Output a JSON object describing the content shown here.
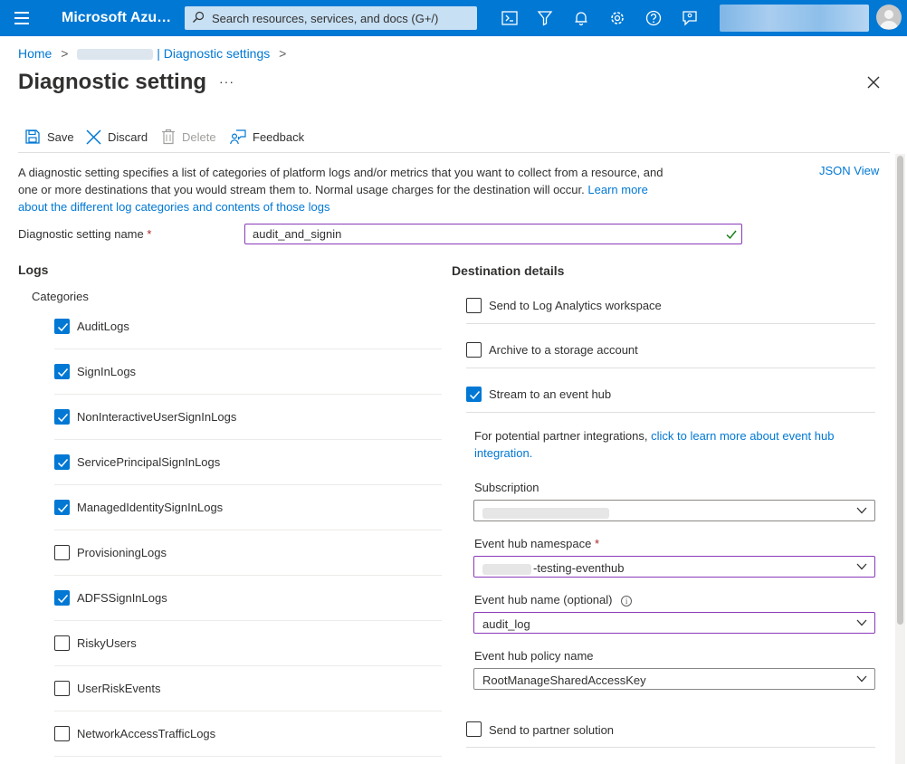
{
  "topbar": {
    "brand": "Microsoft Azu…",
    "search_placeholder": "Search resources, services, and docs (G+/)",
    "icons": [
      "cloud-shell-icon",
      "directory-filter-icon",
      "notifications-icon",
      "settings-icon",
      "help-icon",
      "feedback-icon"
    ]
  },
  "breadcrumb": {
    "home": "Home",
    "parent": "| Diagnostic settings",
    "separator": ">"
  },
  "header": {
    "title": "Diagnostic setting",
    "more": "···"
  },
  "toolbar": {
    "save_label": "Save",
    "discard_label": "Discard",
    "delete_label": "Delete",
    "feedback_label": "Feedback"
  },
  "description": {
    "text": "A diagnostic setting specifies a list of categories of platform logs and/or metrics that you want to collect from a resource, and one or more destinations that you would stream them to. Normal usage charges for the destination will occur. ",
    "link": "Learn more about the different log categories and contents of those logs",
    "json_view": "JSON View"
  },
  "setting_name": {
    "label": "Diagnostic setting name",
    "required_mark": "*",
    "value": "audit_and_signin"
  },
  "logs": {
    "heading": "Logs",
    "categories_heading": "Categories",
    "categories": [
      {
        "label": "AuditLogs",
        "checked": true
      },
      {
        "label": "SignInLogs",
        "checked": true
      },
      {
        "label": "NonInteractiveUserSignInLogs",
        "checked": true
      },
      {
        "label": "ServicePrincipalSignInLogs",
        "checked": true
      },
      {
        "label": "ManagedIdentitySignInLogs",
        "checked": true
      },
      {
        "label": "ProvisioningLogs",
        "checked": false
      },
      {
        "label": "ADFSSignInLogs",
        "checked": true
      },
      {
        "label": "RiskyUsers",
        "checked": false
      },
      {
        "label": "UserRiskEvents",
        "checked": false
      },
      {
        "label": "NetworkAccessTrafficLogs",
        "checked": false
      }
    ]
  },
  "destination": {
    "heading": "Destination details",
    "options": [
      {
        "label": "Send to Log Analytics workspace",
        "checked": false
      },
      {
        "label": "Archive to a storage account",
        "checked": false
      },
      {
        "label": "Stream to an event hub",
        "checked": true
      }
    ],
    "partner_text": "For potential partner integrations, ",
    "partner_link": "click to learn more about event hub integration.",
    "subscription": {
      "label": "Subscription",
      "value": ""
    },
    "namespace": {
      "label": "Event hub namespace",
      "required_mark": "*",
      "value": "-testing-eventhub"
    },
    "hub_name": {
      "label": "Event hub name (optional)",
      "info": "i",
      "value": "audit_log"
    },
    "policy": {
      "label": "Event hub policy name",
      "value": "RootManageSharedAccessKey"
    },
    "partner_solution": {
      "label": "Send to partner solution",
      "checked": false
    }
  },
  "colors": {
    "brand_blue": "#0078d4",
    "focus_purple": "#8a3ab9",
    "required_red": "#a4262c",
    "valid_green": "#107c10"
  }
}
